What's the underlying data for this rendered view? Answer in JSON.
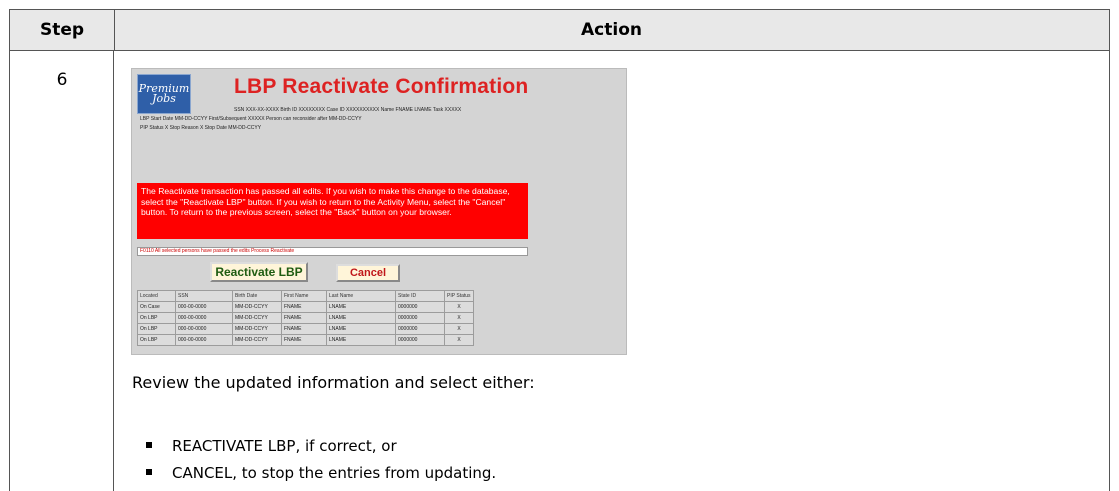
{
  "table": {
    "header_step": "Step",
    "header_action": "Action",
    "step_number": "6"
  },
  "screenshot": {
    "logo_text": "Premium Jobs",
    "title": "LBP Reactivate Confirmation",
    "info_line1": "SSN XXX-XX-XXXX  Birth ID  XXXXXXXX  Case ID  XXXXXXXXXX  Name  FNAME    LNAME    Task  XXXXX",
    "info_line2": "LBP Start Date MM-DD-CCYY   First/Subsequent  XXXXX         Person can reconsider after  MM-DD-CCYY",
    "info_line3": "PIP Status  X        Stop Reason  X        Stop Date  MM-DD-CCYY",
    "message": "The Reactivate transaction has passed all edits.  If you wish to make this change to the database, select the \"Reactivate LBP\" button.  If you wish to return to the Activity Menu, select the \"Cancel\" button.  To return to the previous screen, select the \"Back\" button on your browser.",
    "status_message": "F0110 All selected persons have passed the edits Process Reactivate",
    "reactivate_button": "Reactivate LBP",
    "cancel_button": "Cancel",
    "grid_headers": [
      "Located",
      "SSN",
      "Birth Date",
      "First Name",
      "Last Name",
      "State ID",
      "PIP Status"
    ],
    "grid_rows": [
      [
        "On Case",
        "000-00-0000",
        "MM-DD-CCYY",
        "FNAME",
        "LNAME",
        "0000000",
        "X"
      ],
      [
        "On LBP",
        "000-00-0000",
        "MM-DD-CCYY",
        "FNAME",
        "LNAME",
        "0000000",
        "X"
      ],
      [
        "On LBP",
        "000-00-0000",
        "MM-DD-CCYY",
        "FNAME",
        "LNAME",
        "0000000",
        "X"
      ],
      [
        "On LBP",
        "000-00-0000",
        "MM-DD-CCYY",
        "FNAME",
        "LNAME",
        "0000000",
        "X"
      ]
    ]
  },
  "instructions": {
    "caption": "Review the updated information and select either:",
    "bullets": [
      "REACTIVATE LBP, if correct, or",
      "CANCEL, to stop the entries from updating."
    ]
  },
  "colors": {
    "title_red": "#dd2222",
    "message_bg": "#ff0000",
    "header_bg": "#e8e8e8"
  }
}
